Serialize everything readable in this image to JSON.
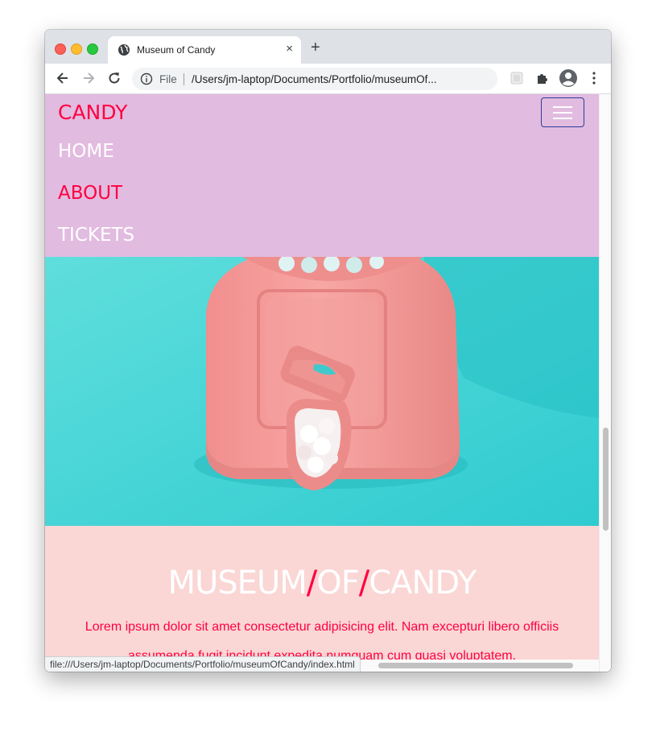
{
  "browser": {
    "tab_title": "Museum of Candy",
    "tab_close": "×",
    "new_tab": "+",
    "file_label": "File",
    "url": "/Users/jm-laptop/Documents/Portfolio/museumOf...",
    "status_url": "file:///Users/jm-laptop/Documents/Portfolio/museumOfCandy/index.html"
  },
  "navbar": {
    "brand": "CANDY",
    "items": [
      {
        "label": "HOME",
        "color": "#ffffff"
      },
      {
        "label": "ABOUT",
        "color": "#ff0040"
      },
      {
        "label": "TICKETS",
        "color": "#ffffff"
      }
    ]
  },
  "hero": {
    "title_parts": [
      "MUSEUM",
      "/",
      "OF",
      "/",
      "CANDY"
    ],
    "description": "Lorem ipsum dolor sit amet consectetur adipisicing elit. Nam excepturi libero officiis assumenda fugit incidunt expedita numquam cum quasi voluptatem."
  },
  "colors": {
    "navbar_bg": "#e2bbe0",
    "accent": "#ff0040",
    "content_bg": "#fad6d5",
    "hero_bg": "#3fd3d6"
  }
}
